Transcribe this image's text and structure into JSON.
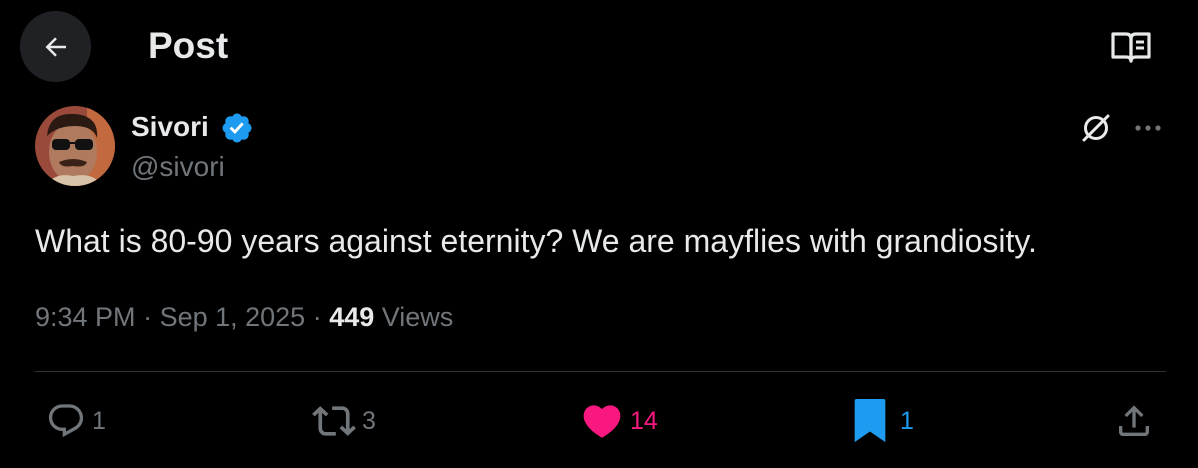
{
  "header": {
    "title": "Post",
    "back_icon": "arrow-left-icon",
    "reader_icon": "reader-mode-icon"
  },
  "author": {
    "name": "Sivori",
    "handle": "@sivori",
    "verified": true
  },
  "post": {
    "text": "What is 80-90 years against eternity? We are mayflies with grandiosity.",
    "time": "9:34 PM",
    "date": "Sep 1, 2025",
    "separator": " · ",
    "views_count": "449",
    "views_label": " Views"
  },
  "actions": {
    "reply_count": "1",
    "repost_count": "3",
    "like_count": "14",
    "bookmark_count": "1"
  },
  "colors": {
    "background": "#000000",
    "text_primary": "#e7e9ea",
    "text_secondary": "#71767b",
    "verified_blue": "#1d9bf0",
    "like_pink": "#f91880",
    "bookmark_blue": "#1d9bf0",
    "divider": "#2f3336"
  }
}
